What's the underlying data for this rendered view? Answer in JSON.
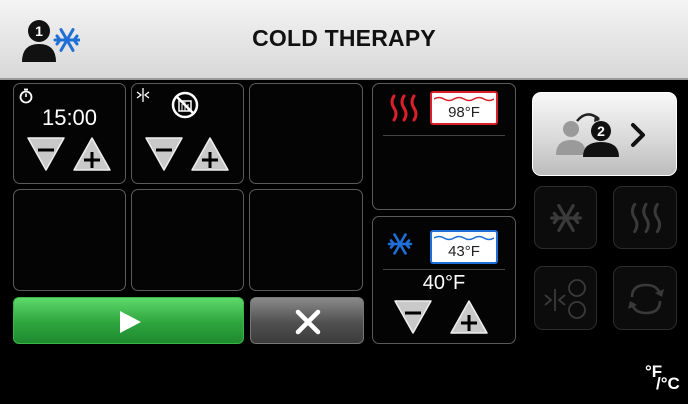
{
  "header": {
    "title": "COLD THERAPY",
    "user_number": "1"
  },
  "timer": {
    "value": "15:00"
  },
  "hot_bath": {
    "current_temp": "98°F"
  },
  "cold_bath": {
    "current_temp": "43°F",
    "setpoint": "40°F"
  },
  "switch_user": {
    "user_number": "2"
  },
  "units": {
    "label_f": "°F",
    "label_c": "/°C"
  },
  "colors": {
    "accent_blue": "#1f6fd6",
    "heat_red": "#d8202a",
    "start_green": "#2fa53e"
  }
}
